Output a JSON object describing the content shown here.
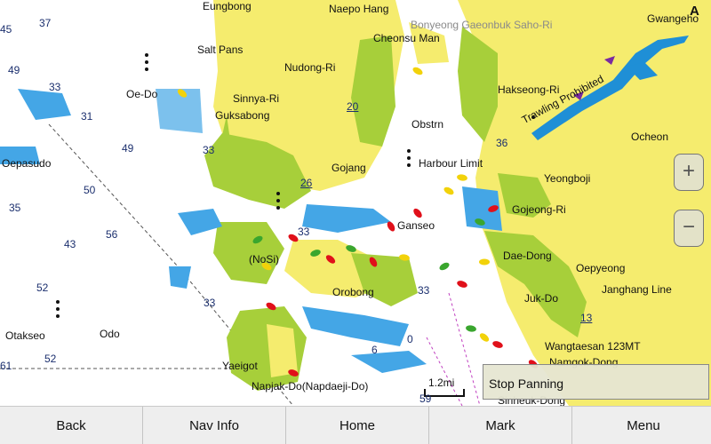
{
  "map": {
    "compass": "A",
    "places": [
      {
        "id": "eungbong",
        "text": "Eungbong"
      },
      {
        "id": "naepo-hang",
        "text": "Naepo Hang"
      },
      {
        "id": "bonyeong",
        "text": "Bonyeong Gaeonbuk Saho-Ri"
      },
      {
        "id": "gwangeho",
        "text": "Gwangeho"
      },
      {
        "id": "cheonsu-man",
        "text": "Cheonsu Man"
      },
      {
        "id": "salt-pans",
        "text": "Salt Pans"
      },
      {
        "id": "nudong-ri",
        "text": "Nudong-Ri"
      },
      {
        "id": "hakseong-ri",
        "text": "Hakseong-Ri"
      },
      {
        "id": "oe-do",
        "text": "Oe-Do"
      },
      {
        "id": "sinnya-ri",
        "text": "Sinnya-Ri"
      },
      {
        "id": "trawling-prohibited",
        "text": "Trawling Prohibited"
      },
      {
        "id": "guksabong",
        "text": "Guksabong"
      },
      {
        "id": "obstrn",
        "text": "Obstrn"
      },
      {
        "id": "ocheon",
        "text": "Ocheon"
      },
      {
        "id": "oepasudo",
        "text": "Oepasudo"
      },
      {
        "id": "harbour-limit",
        "text": "Harbour Limit"
      },
      {
        "id": "gojang",
        "text": "Gojang"
      },
      {
        "id": "yeongboji",
        "text": "Yeongboji"
      },
      {
        "id": "gojeong-ri",
        "text": "Gojeong-Ri"
      },
      {
        "id": "ganseo",
        "text": "Ganseo"
      },
      {
        "id": "nosi",
        "text": "(NoSi)"
      },
      {
        "id": "dae-dong",
        "text": "Dae-Dong"
      },
      {
        "id": "oepyeong",
        "text": "Oepyeong"
      },
      {
        "id": "orobong",
        "text": "Orobong"
      },
      {
        "id": "jangchang-line",
        "text": "Janghang Line"
      },
      {
        "id": "juk-do",
        "text": "Juk-Do"
      },
      {
        "id": "otakseo",
        "text": "Otakseo"
      },
      {
        "id": "odo",
        "text": "Odo"
      },
      {
        "id": "wangtaesan",
        "text": "Wangtaesan 123MT"
      },
      {
        "id": "yaeigot",
        "text": "Yaeigot"
      },
      {
        "id": "napjak-do",
        "text": "Napjak-Do(Napdaeji-Do)"
      },
      {
        "id": "namgok-dong",
        "text": "Namgok-Dong"
      },
      {
        "id": "sinheuk-dong",
        "text": "Sinheuk-Dong"
      }
    ],
    "depths": [
      {
        "id": "d45",
        "text": "45"
      },
      {
        "id": "d37",
        "text": "37"
      },
      {
        "id": "d49a",
        "text": "49"
      },
      {
        "id": "d31",
        "text": "31"
      },
      {
        "id": "d49b",
        "text": "49"
      },
      {
        "id": "d50",
        "text": "50"
      },
      {
        "id": "d35",
        "text": "35"
      },
      {
        "id": "d43",
        "text": "43"
      },
      {
        "id": "d56",
        "text": "56"
      },
      {
        "id": "d52a",
        "text": "52"
      },
      {
        "id": "d52b",
        "text": "52"
      },
      {
        "id": "d61",
        "text": "61"
      },
      {
        "id": "d33a",
        "text": "33"
      },
      {
        "id": "d33b",
        "text": "33"
      },
      {
        "id": "d33c",
        "text": "33"
      },
      {
        "id": "d33d",
        "text": "33"
      },
      {
        "id": "d20",
        "text": "20"
      },
      {
        "id": "d26",
        "text": "26"
      },
      {
        "id": "d13",
        "text": "13"
      },
      {
        "id": "d0a",
        "text": "0"
      },
      {
        "id": "d6",
        "text": "6"
      },
      {
        "id": "d59",
        "text": "59"
      },
      {
        "id": "d36",
        "text": "36"
      },
      {
        "id": "d33e",
        "text": "33"
      }
    ],
    "scale_label": "1.2mi"
  },
  "zoom": {
    "in_label": "+",
    "out_label": "−"
  },
  "panning": {
    "label": "Stop Panning"
  },
  "toolbar": {
    "back": "Back",
    "nav_info": "Nav Info",
    "home": "Home",
    "mark": "Mark",
    "menu": "Menu"
  },
  "colors": {
    "land": "#f5ec6e",
    "intertidal": "#a7cf3a",
    "shallow": "#44a6e6",
    "water": "#ffffff",
    "river": "#1f8fd6",
    "marker_red": "#e0101a",
    "marker_green": "#3aa62e",
    "marker_yellow": "#f2d20a"
  }
}
